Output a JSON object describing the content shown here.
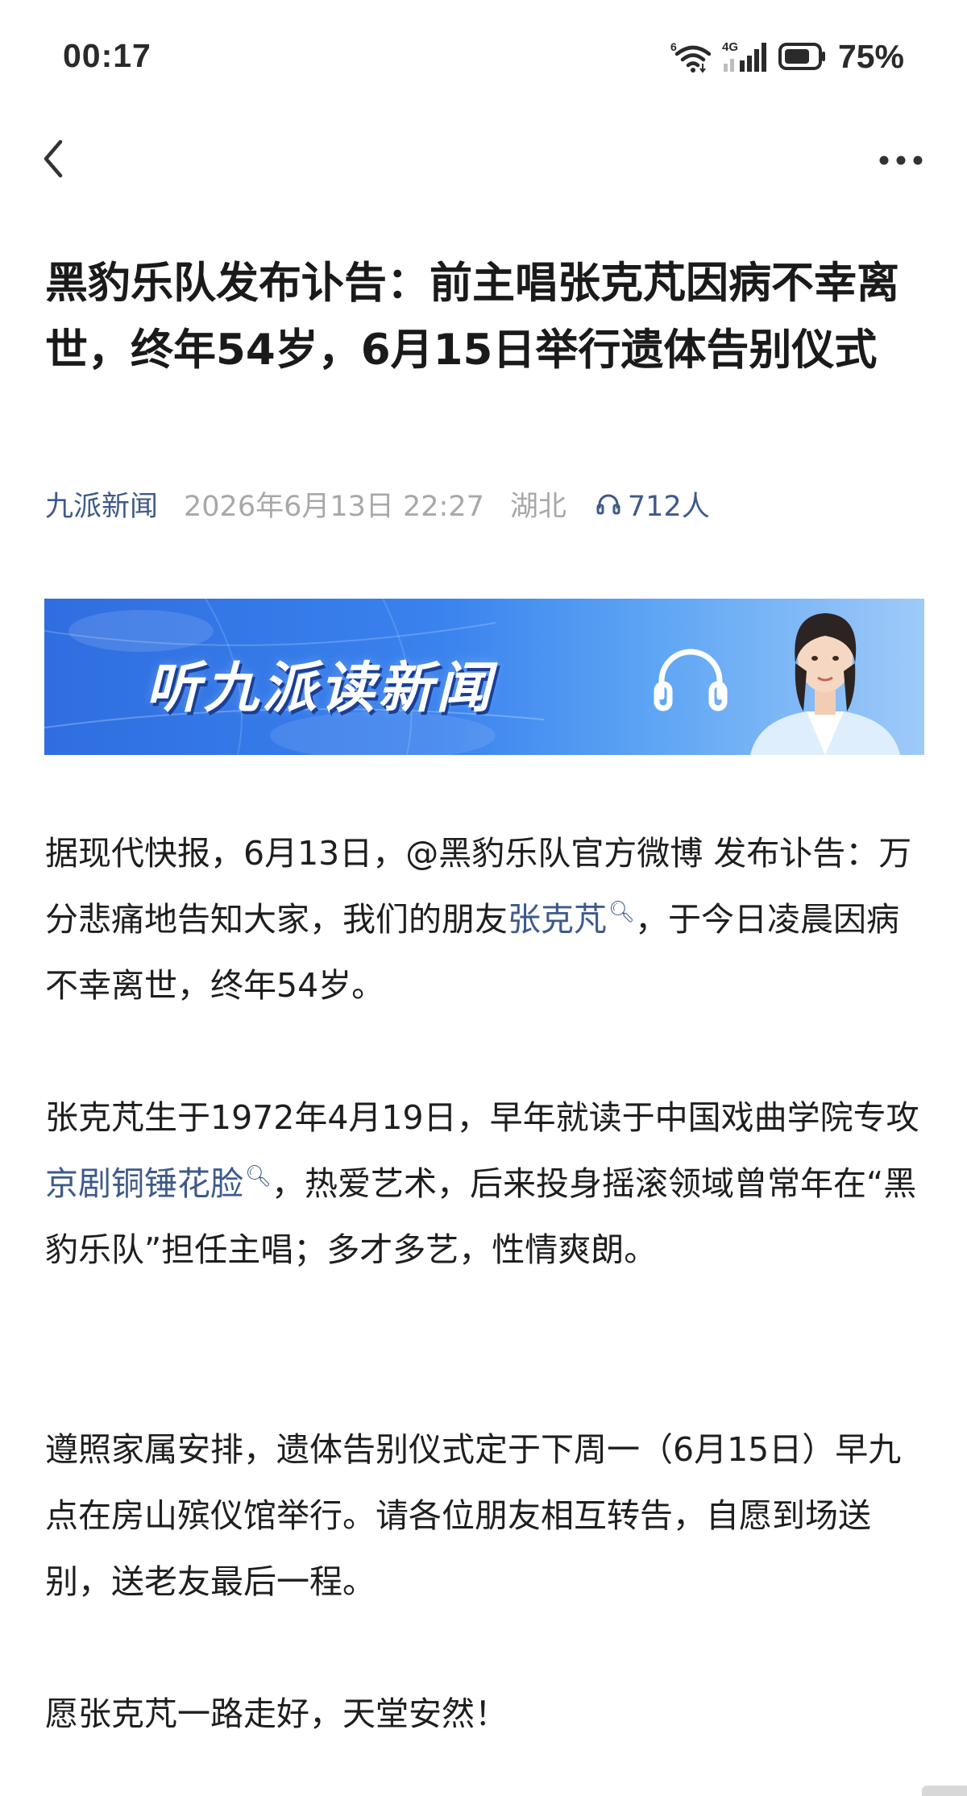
{
  "status_bar": {
    "time": "00:17",
    "wifi_tag": "6",
    "network": "4G",
    "battery": "75%"
  },
  "nav": {
    "back_icon": "chevron-left-icon",
    "more_icon": "more-horizontal-icon"
  },
  "article": {
    "title": "黑豹乐队发布讣告：前主唱张克芃因病不幸离世，终年54岁，6月15日举行遗体告别仪式",
    "source": "九派新闻",
    "date": "2026年6月13日 22:27",
    "region": "湖北",
    "listeners": "712人"
  },
  "banner": {
    "text": "听九派读新闻",
    "colors": {
      "start": "#2f6ee0",
      "end": "#9fcaf8"
    }
  },
  "body": {
    "p1": {
      "before": "据现代快报，6月13日，@黑豹乐队官方微博 发布讣告：万分悲痛地告知大家，我们的朋友",
      "link": "张克芃",
      "after": "，于今日凌晨因病不幸离世，终年54岁。"
    },
    "p2": {
      "before": "张克芃生于1972年4月19日，早年就读于中国戏曲学院专攻",
      "link": "京剧铜锤花脸",
      "after": "，热爱艺术，后来投身摇滚领域曾常年在“黑豹乐队”担任主唱；多才多艺，性情爽朗。"
    },
    "p3": "遵照家属安排，遗体告别仪式定于下周一（6月15日）早九点在房山殡仪馆举行。请各位朋友相互转告，自愿到场送别，送老友最后一程。",
    "p4": "愿张克芃一路走好，天堂安然！"
  },
  "colors": {
    "link": "#3e5a8a",
    "meta_gray": "#a8a8a8",
    "text": "#1e1e1e"
  }
}
